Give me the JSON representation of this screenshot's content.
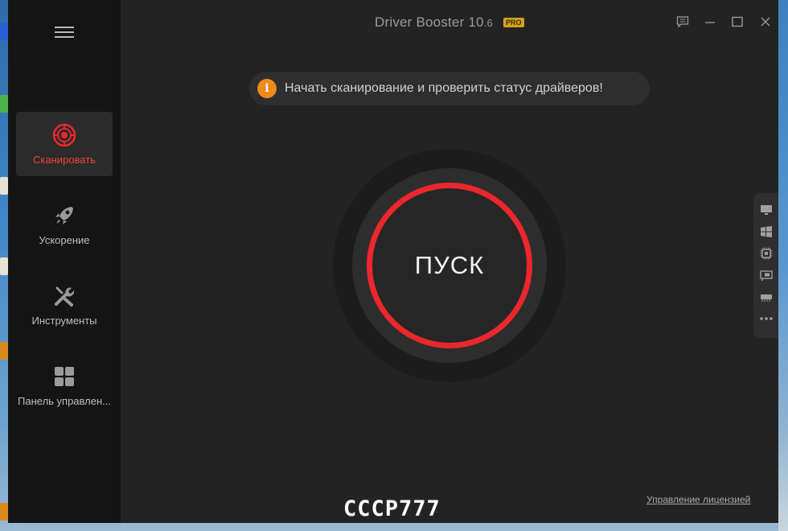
{
  "app": {
    "title_main": "Driver Booster 10",
    "title_version": ".6",
    "badge": "PRO"
  },
  "sidebar": {
    "menu_icon": "hamburger-icon",
    "items": [
      {
        "label": "Сканировать",
        "icon": "scan-icon",
        "active": true
      },
      {
        "label": "Ускорение",
        "icon": "rocket-icon",
        "active": false
      },
      {
        "label": "Инструменты",
        "icon": "tools-icon",
        "active": false
      },
      {
        "label": "Панель управлен...",
        "icon": "dashboard-icon",
        "active": false
      }
    ]
  },
  "window_controls": [
    "feedback-icon",
    "minimize-icon",
    "maximize-icon",
    "close-icon"
  ],
  "tip": {
    "icon": "info-icon",
    "icon_glyph": "i",
    "text": "Начать сканирование и проверить статус драйверов!"
  },
  "scan": {
    "label": "ПУСК"
  },
  "side_panel": {
    "icons": [
      "monitor-icon",
      "windows-icon",
      "cpu-icon",
      "network-card-icon",
      "memory-icon",
      "more-icon"
    ]
  },
  "footer": {
    "license_link": "Управление лицензией",
    "watermark": "CCCP777"
  },
  "colors": {
    "accent_red": "#e9272c",
    "active_label": "#f0433a",
    "info_orange": "#f08a1c",
    "pro_badge": "#d4a21b",
    "background": "#232323",
    "sidebar": "#141414"
  }
}
